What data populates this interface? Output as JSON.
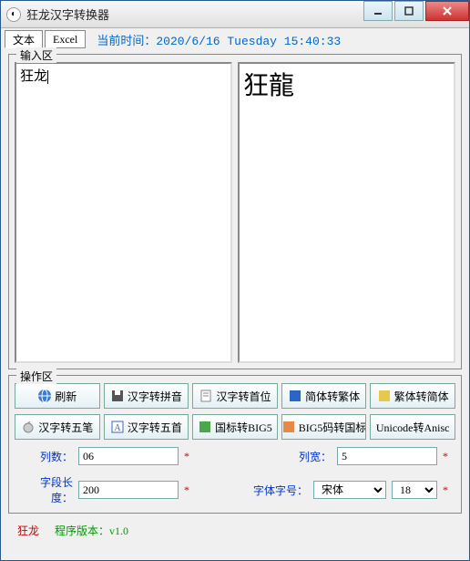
{
  "window": {
    "title": "狂龙汉字转换器"
  },
  "toolbar": {
    "tab_text": "文本",
    "tab_excel": "Excel",
    "time_prefix": "当前时间：",
    "time_value": "2020/6/16 Tuesday  15:40:33"
  },
  "input_group": {
    "legend": "输入区",
    "left_value": "狂龙",
    "right_value": "狂龍"
  },
  "ops_group": {
    "legend": "操作区",
    "row1": [
      {
        "label": "刷新",
        "icon": "globe"
      },
      {
        "label": "汉字转拼音",
        "icon": "disk"
      },
      {
        "label": "汉字转首位",
        "icon": "doc"
      },
      {
        "label": "简体转繁体",
        "icon": "sq-blue"
      },
      {
        "label": "繁体转简体",
        "icon": "sq-yellow"
      }
    ],
    "row2": [
      {
        "label": "汉字转五笔",
        "icon": "apple"
      },
      {
        "label": "汉字转五首",
        "icon": "letter"
      },
      {
        "label": "国标转BIG5",
        "icon": "sq-green"
      },
      {
        "label": "BIG5码转国标",
        "icon": "sq-orange"
      },
      {
        "label": "Unicode转Anisc",
        "icon": ""
      }
    ]
  },
  "fields": {
    "cols_label": "列数：",
    "cols_value": "06",
    "width_label": "列宽：",
    "width_value": "5",
    "seglen_label": "字段长度：",
    "seglen_value": "200",
    "fontsize_label": "字体字号：",
    "font_value": "宋体",
    "size_value": "18",
    "star": "*"
  },
  "status": {
    "name": "狂龙",
    "version": "程序版本：v1.0"
  },
  "icons": {
    "globe": "#3a7bd5",
    "disk": "#555",
    "doc": "#888",
    "sq-blue": "#2a65c8",
    "sq-yellow": "#e6c84a",
    "apple": "#888",
    "letter": "#3a65c8",
    "sq-green": "#4aa84a",
    "sq-orange": "#e6884a"
  }
}
